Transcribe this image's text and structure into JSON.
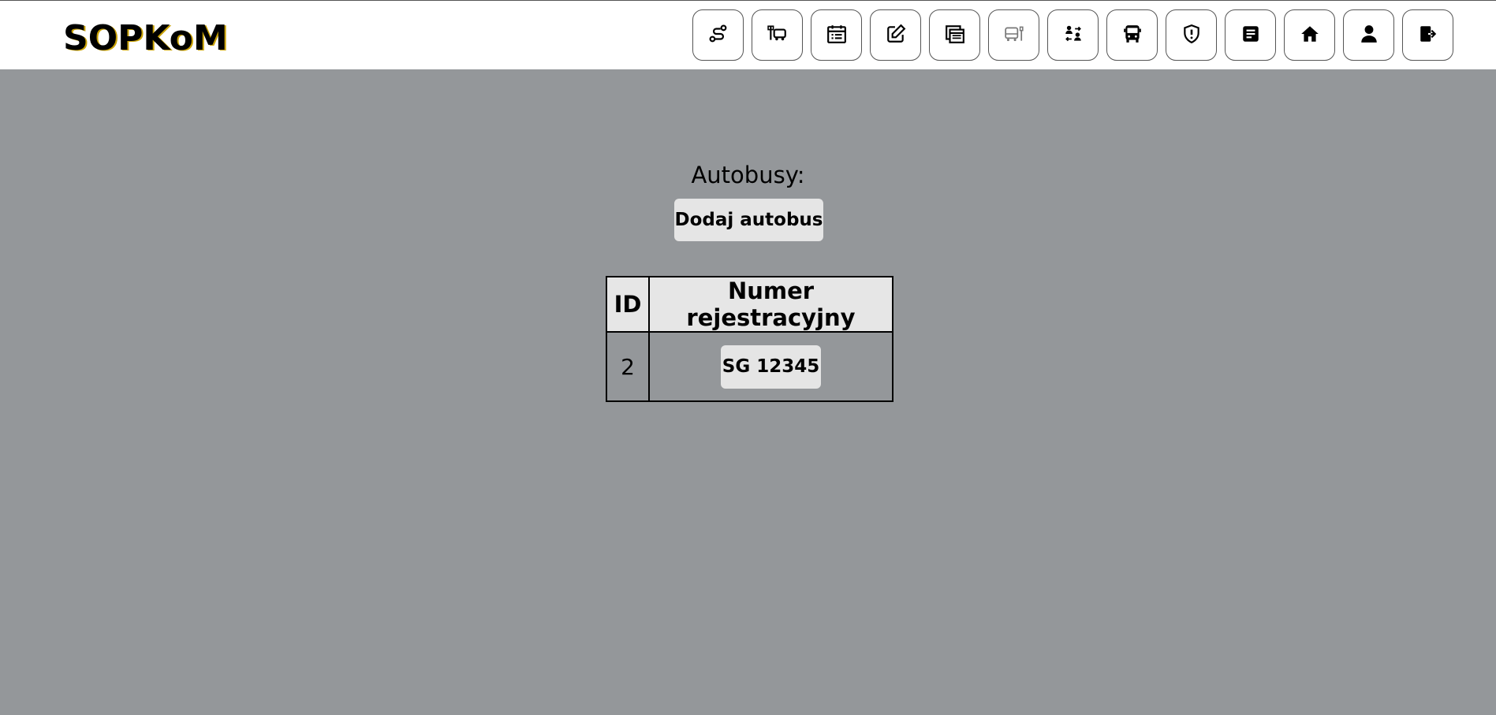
{
  "app": {
    "logo_text": "SOPKoM"
  },
  "nav": {
    "buttons": [
      {
        "icon": "route-icon"
      },
      {
        "icon": "bus-stop-edit-icon"
      },
      {
        "icon": "calendar-list-icon"
      },
      {
        "icon": "edit-icon"
      },
      {
        "icon": "schedules-icon"
      },
      {
        "icon": "bus-stop-icon"
      },
      {
        "icon": "drivers-swap-icon"
      },
      {
        "icon": "bus-icon"
      },
      {
        "icon": "shield-alert-icon"
      },
      {
        "icon": "document-icon"
      },
      {
        "icon": "home-icon"
      },
      {
        "icon": "user-icon"
      },
      {
        "icon": "logout-icon"
      }
    ]
  },
  "main": {
    "heading": "Autobusy:",
    "add_button_label": "Dodaj autobus",
    "table": {
      "columns": [
        "ID",
        "Numer rejestracyjny"
      ],
      "rows": [
        {
          "id": "2",
          "registration": "SG 12345"
        }
      ]
    }
  },
  "colors": {
    "background": "#94979a",
    "topbar": "#ffffff",
    "button_bg": "#e5e5e5",
    "table_header_bg": "#e6e6e6"
  }
}
